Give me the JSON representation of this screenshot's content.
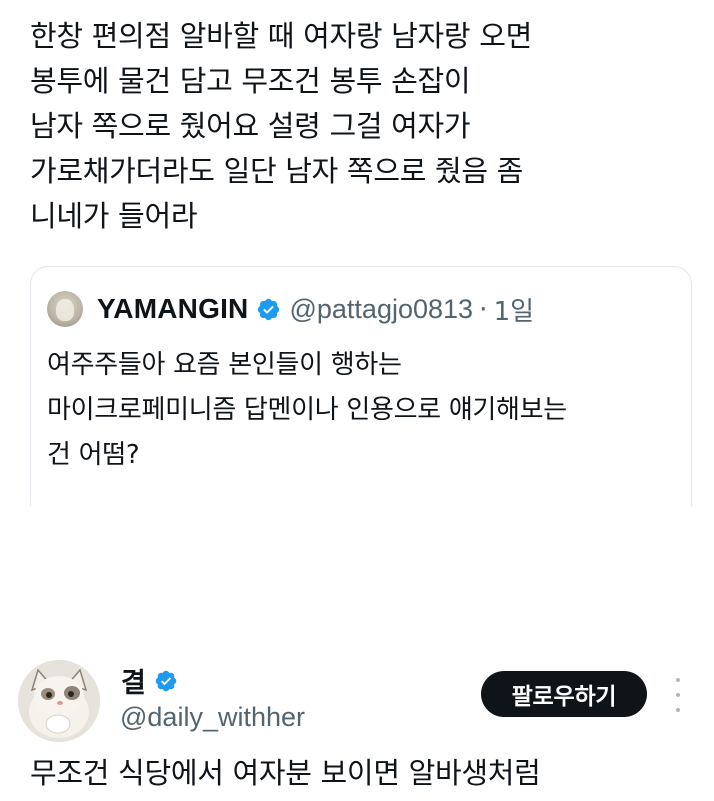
{
  "main_tweet": {
    "lines": [
      "한창 편의점 알바할 때 여자랑 남자랑 오면",
      "봉투에 물건 담고 무조건 봉투 손잡이",
      "남자 쪽으로 줬어요 설령 그걸 여자가",
      "가로채가더라도 일단 남자 쪽으로 줬음 좀",
      "니네가 들어라"
    ]
  },
  "quoted_tweet": {
    "display_name": "YAMANGIN",
    "handle": "@pattagjo0813",
    "separator": "·",
    "time": "1일",
    "lines": [
      "여주주들아 요즘 본인들이 행하는",
      "마이크로페미니즘 답멘이나 인용으로 얘기해보는",
      "건 어떰?"
    ]
  },
  "reply": {
    "display_name": "결",
    "handle": "@daily_withher",
    "follow_label": "팔로우하기",
    "text": "무조건 식당에서 여자분 보이면 알바생처럼"
  },
  "icons": {
    "verified": "verified-badge-icon",
    "more": "more-options-icon"
  },
  "colors": {
    "text": "#0f1419",
    "secondary": "#536471",
    "verified_blue": "#1d9bf0",
    "button_bg": "#0f1419",
    "border": "#e3e6ea"
  }
}
